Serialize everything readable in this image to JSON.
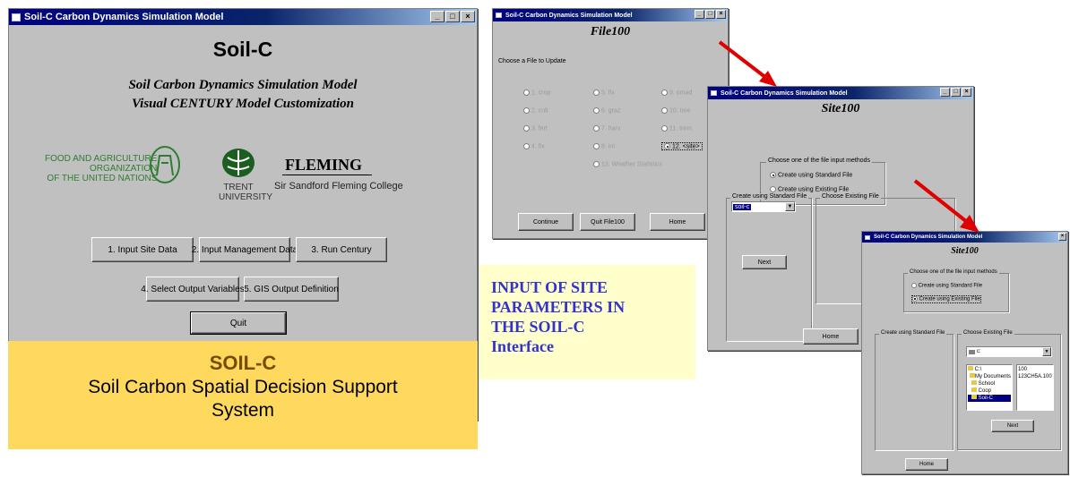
{
  "main_window": {
    "title": "Soil-C Carbon Dynamics Simulation Model",
    "heading": "Soil-C",
    "subtitle_1": "Soil Carbon Dynamics Simulation Model",
    "subtitle_2": "Visual CENTURY Model Customization",
    "fao_text": [
      "FOOD AND AGRICULTURE",
      "ORGANIZATION",
      "OF THE UNITED NATIONS"
    ],
    "trent_text": [
      "TRENT",
      "UNIVERSITY"
    ],
    "fleming_name": "FLEMING",
    "fleming_text": "Sir Sandford Fleming College",
    "buttons": {
      "input_site": "1. Input Site Data",
      "input_mgmt": "2. Input Management Data",
      "run_century": "3. Run Century",
      "select_output": "4. Select Output Variables",
      "gis_output": "5. GIS Output Definition",
      "quit": "Quit"
    }
  },
  "caption": {
    "title": "SOIL-C",
    "line1": "Soil Carbon Spatial Decision Support",
    "line2": "System"
  },
  "callout": {
    "lines": [
      "INPUT OF SITE",
      "PARAMETERS IN",
      "THE SOIL-C",
      "Interface"
    ]
  },
  "file_window": {
    "title": "Soil-C Carbon Dynamics Simulation Model",
    "heading": "File100",
    "prompt": "Choose a File to Update",
    "options": [
      {
        "label": "1. crop",
        "selected": false
      },
      {
        "label": "2. cult",
        "selected": false
      },
      {
        "label": "3. fert",
        "selected": false
      },
      {
        "label": "4. fix",
        "selected": false
      },
      {
        "label": "5. fix",
        "selected": false
      },
      {
        "label": "6. graz",
        "selected": false
      },
      {
        "label": "7. harv",
        "selected": false
      },
      {
        "label": "8. irri",
        "selected": false
      },
      {
        "label": "9. omad",
        "selected": false
      },
      {
        "label": "10. tree",
        "selected": false
      },
      {
        "label": "11. trem",
        "selected": false
      },
      {
        "label": "12. <site>",
        "selected": true
      },
      {
        "label": "13. Weather Statistics",
        "selected": false
      }
    ],
    "buttons": {
      "continue": "Continue",
      "quit": "Quit File100",
      "home": "Home"
    }
  },
  "site_window": {
    "title": "Soil-C Carbon Dynamics Simulation Model",
    "heading": "Site100",
    "group_label": "Choose one of the file input methods",
    "option_standard": "Create using Standard File",
    "option_existing": "Create using Existing File",
    "standard_label": "Create using Standard File",
    "existing_label": "Choose Existing File",
    "select_value": "soil-c",
    "next": "Next",
    "home": "Home"
  },
  "site_window_2": {
    "title": "Soil-C Carbon Dynamics Simulation Model",
    "heading": "Site100",
    "group_label": "Choose one of the file input methods",
    "option_standard": "Create using Standard File",
    "option_existing": "Create using Existing File",
    "standard_label": "Create using Standard File",
    "existing_label": "Choose Existing File",
    "drive_value": "c:",
    "folders": [
      "C:\\",
      "My Documents",
      "School",
      "Coop",
      "Soil-C"
    ],
    "files": [
      "100",
      "123CH5A.100"
    ],
    "next": "Next",
    "home": "Home"
  },
  "colors": {
    "window_gray": "#c0c0c0",
    "title_blue": "#000080",
    "caption_yellow": "#fed95e",
    "callout_yellow": "#ffffcc",
    "callout_text": "#3333cc",
    "fao_green": "#2e7d32",
    "arrow_red": "#e00000",
    "caption_title": "#7a4a00"
  }
}
